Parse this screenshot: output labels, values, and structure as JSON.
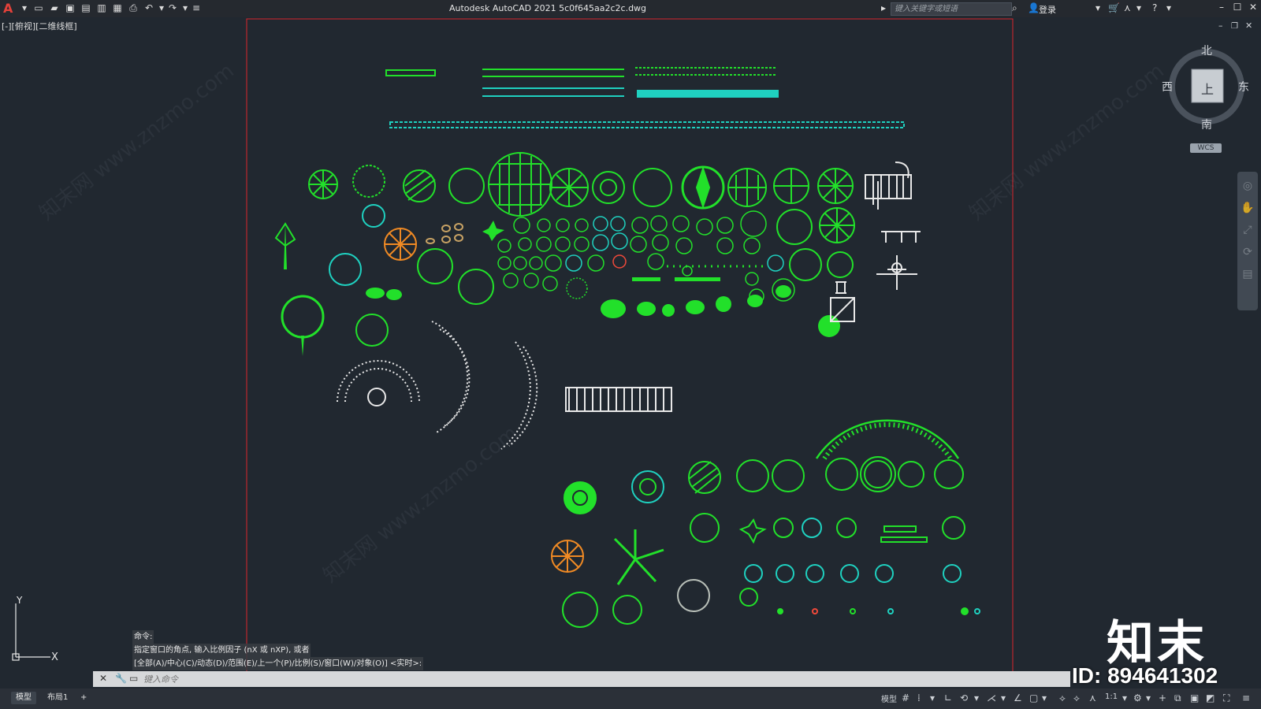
{
  "titlebar": {
    "app_logo": "A",
    "title": "Autodesk AutoCAD 2021    5c0f645aa2c2c.dwg",
    "search_placeholder": "键入关键字或短语",
    "login": "登录"
  },
  "viewport": {
    "label": "[-][俯视][二维线框]"
  },
  "viewcube": {
    "north": "北",
    "south": "南",
    "east": "东",
    "west": "西",
    "face": "上",
    "wcs": "WCS"
  },
  "ucs": {
    "x": "X",
    "y": "Y"
  },
  "command": {
    "history": [
      "命令:",
      "指定窗口的角点, 输入比例因子 (nX 或 nXP), 或者",
      "[全部(A)/中心(C)/动态(D)/范围(E)/上一个(P)/比例(S)/窗口(W)/对象(O)] <实时>:"
    ],
    "input_placeholder": "键入命令"
  },
  "status": {
    "tabs": [
      "模型",
      "布局1",
      "+"
    ],
    "model_label": "模型",
    "scale": "1:1"
  },
  "watermark": {
    "logo": "知末",
    "id": "ID: 894641302",
    "site": "知末网 www.znzmo.com"
  },
  "colors": {
    "background": "#212830",
    "frame": "#d9262b",
    "green": "#22e02a",
    "cyan": "#1fd1c0",
    "orange": "#f08a24",
    "white": "#e8e8e8"
  }
}
